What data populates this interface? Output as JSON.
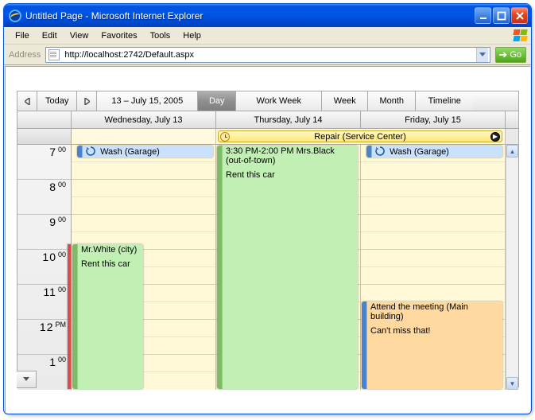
{
  "window": {
    "title": "Untitled Page - Microsoft Internet Explorer"
  },
  "menu": {
    "file": "File",
    "edit": "Edit",
    "view": "View",
    "favorites": "Favorites",
    "tools": "Tools",
    "help": "Help"
  },
  "address": {
    "label": "Address",
    "url": "http://localhost:2742/Default.aspx",
    "go": "Go"
  },
  "scheduler": {
    "today": "Today",
    "range": "13 – July 15, 2005",
    "views": {
      "day": "Day",
      "work_week": "Work Week",
      "week": "Week",
      "month": "Month",
      "timeline": "Timeline"
    },
    "days": {
      "wed": "Wednesday, July 13",
      "thu": "Thursday, July 14",
      "fri": "Friday, July 15"
    },
    "allday": {
      "repair": "Repair (Service Center)"
    },
    "hours": [
      {
        "hr": "7",
        "mn": "00"
      },
      {
        "hr": "8",
        "mn": "00"
      },
      {
        "hr": "9",
        "mn": "00"
      },
      {
        "hr": "10",
        "mn": "00"
      },
      {
        "hr": "11",
        "mn": "00"
      },
      {
        "hr": "12",
        "mn": "PM"
      },
      {
        "hr": "1",
        "mn": "00"
      }
    ],
    "events": {
      "wed_wash": "Wash (Garage)",
      "wed_white_title": "Mr.White (city)",
      "wed_white_note": "Rent this car",
      "thu_black_title": "3:30 PM-2:00 PM Mrs.Black (out-of-town)",
      "thu_black_note": "Rent this car",
      "fri_wash": "Wash (Garage)",
      "fri_meeting_title": "Attend the meeting (Main building)",
      "fri_meeting_note": "Can't miss that!"
    }
  }
}
